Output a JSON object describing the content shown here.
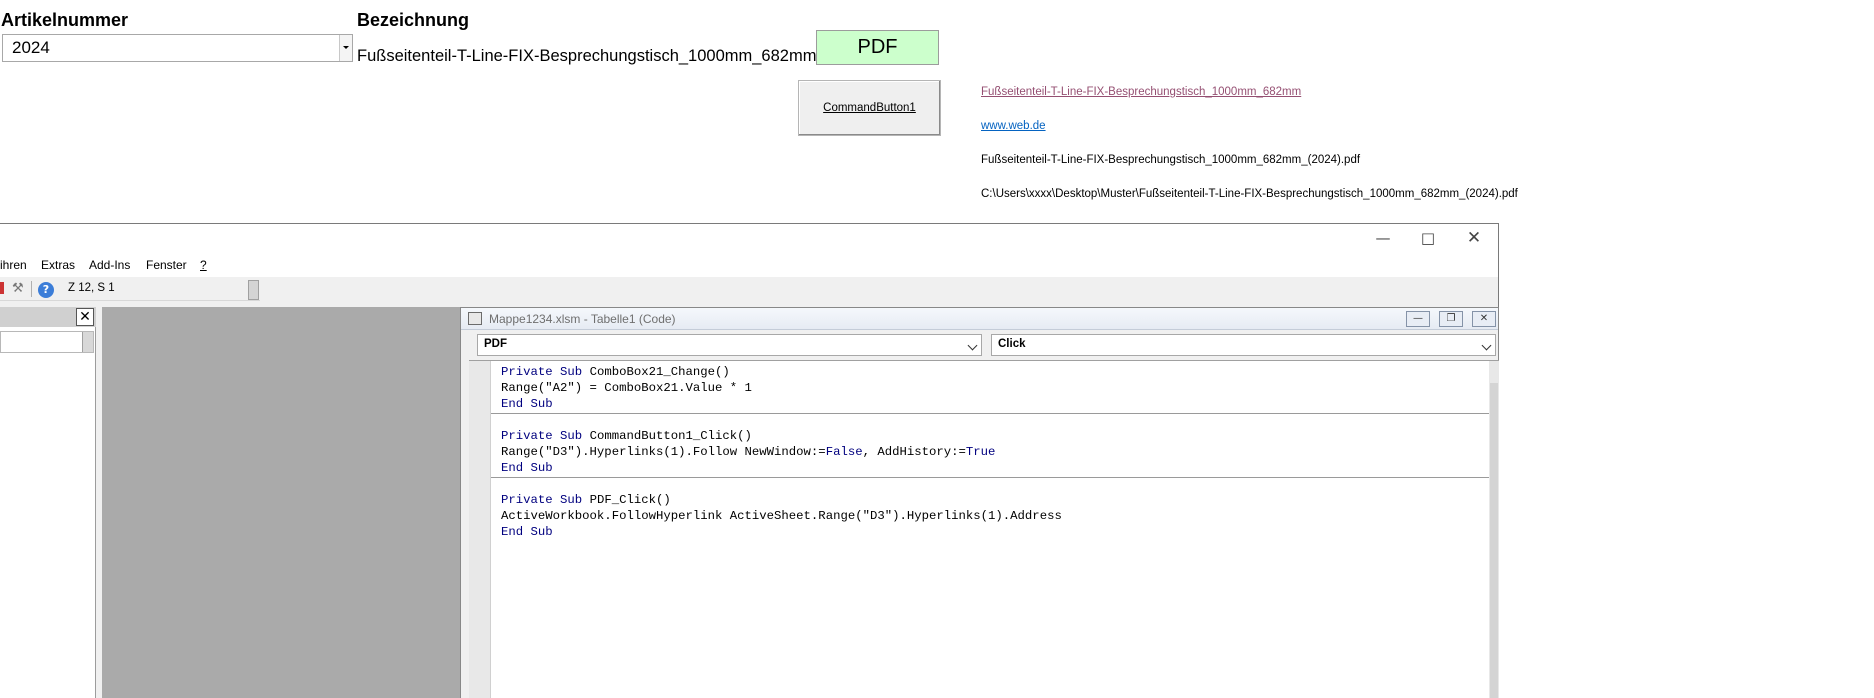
{
  "sheet": {
    "header_article": "Artikelnummer",
    "header_desc": "Bezeichnung",
    "combo_value": "2024",
    "description": "Fußseitenteil-T-Line-FIX-Besprechungstisch_1000mm_682mm",
    "pdf_button": "PDF",
    "command_button": "CommandButton1",
    "cell_link1": "Fußseitenteil-T-Line-FIX-Besprechungstisch_1000mm_682mm",
    "cell_link2": "www.web.de",
    "cell_filename": "Fußseitenteil-T-Line-FIX-Besprechungstisch_1000mm_682mm_(2024).pdf",
    "cell_path": "C:\\Users\\xxxx\\Desktop\\Muster\\Fußseitenteil-T-Line-FIX-Besprechungstisch_1000mm_682mm_(2024).pdf"
  },
  "vbe": {
    "menu": [
      "ihren",
      "Extras",
      "Add-Ins",
      "Fenster",
      "?"
    ],
    "position": "Z 12, S 1",
    "code_window_title": "Mappe1234.xlsm - Tabelle1 (Code)",
    "object_combo": "PDF",
    "procedure_combo": "Click",
    "code": {
      "l1_kw": "Private Sub",
      "l1_rest": " ComboBox21_Change()",
      "l2": "Range(\"A2\") = ComboBox21.Value * 1",
      "l3": "End Sub",
      "l4_kw": "Private Sub",
      "l4_rest": " CommandButton1_Click()",
      "l5_a": "Range(\"D3\").Hyperlinks(1).Follow NewWindow:=",
      "l5_false": "False",
      "l5_b": ", AddHistory:=",
      "l5_true": "True",
      "l6": "End Sub",
      "l7_kw": "Private Sub",
      "l7_rest": " PDF_Click()",
      "l8": "ActiveWorkbook.FollowHyperlink ActiveSheet.Range(\"D3\").Hyperlinks(1).Address",
      "l9": "End Sub"
    }
  },
  "colors": {
    "pdf_button_bg": "#ccffcc",
    "keyword": "#00007f",
    "visited_link": "#954f72",
    "link": "#0563c1"
  }
}
